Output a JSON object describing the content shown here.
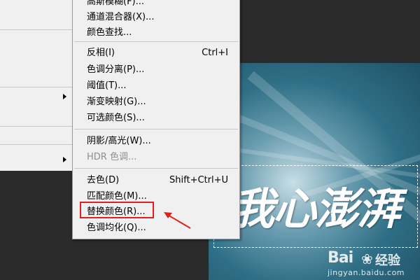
{
  "menu": {
    "items": [
      {
        "label": "高斯模糊(F)...",
        "shortcut": "",
        "disabled": false
      },
      {
        "label": "通道混合器(X)...",
        "shortcut": "",
        "disabled": false
      },
      {
        "label": "颜色查找...",
        "shortcut": "",
        "disabled": false
      },
      {
        "label": "反相(I)",
        "shortcut": "Ctrl+I",
        "disabled": false
      },
      {
        "label": "色调分离(P)...",
        "shortcut": "",
        "disabled": false
      },
      {
        "label": "阈值(T)...",
        "shortcut": "",
        "disabled": false
      },
      {
        "label": "渐变映射(G)...",
        "shortcut": "",
        "disabled": false
      },
      {
        "label": "可选颜色(S)...",
        "shortcut": "",
        "disabled": false
      },
      {
        "label": "阴影/高光(W)...",
        "shortcut": "",
        "disabled": false
      },
      {
        "label": "HDR 色调...",
        "shortcut": "",
        "disabled": true
      },
      {
        "label": "去色(D)",
        "shortcut": "Shift+Ctrl+U",
        "disabled": false
      },
      {
        "label": "匹配颜色(M)...",
        "shortcut": "",
        "disabled": false
      },
      {
        "label": "替换颜色(R)...",
        "shortcut": "",
        "disabled": false
      },
      {
        "label": "色调均化(Q)...",
        "shortcut": "",
        "disabled": false
      }
    ],
    "highlighted_item": "替换颜色(R)..."
  },
  "canvas": {
    "headline": "我心澎湃"
  },
  "watermark": {
    "logo": "Bai",
    "logo_suffix": "经验",
    "url": "jingyan.baidu.com"
  },
  "colors": {
    "menu_bg": "#f0f0f0",
    "workspace_bg": "#2a2a2a",
    "highlight_red": "#e02020",
    "disabled_text": "#8f8f8f"
  }
}
